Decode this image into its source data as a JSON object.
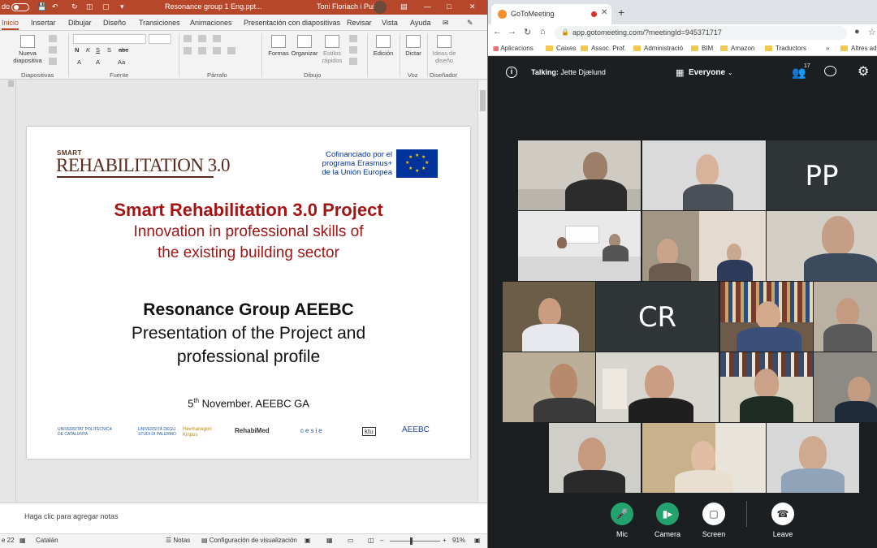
{
  "powerpoint": {
    "title_bar": {
      "autosave_label": "do",
      "file_name": "Resonance group 1 Eng.ppt...",
      "user_name": "Toni Floriach i Puig"
    },
    "ribbon_tabs": [
      "Inicio",
      "Insertar",
      "Dibujar",
      "Diseño",
      "Transiciones",
      "Animaciones",
      "Presentación con diapositivas",
      "Revisar",
      "Vista",
      "Ayuda"
    ],
    "ribbon": {
      "new_slide": "Nueva diapositiva",
      "shapes": "Formas",
      "arrange": "Organizar",
      "quick_styles": "Estilos rápidos",
      "edit": "Edición",
      "dictate": "Dictar",
      "design_ideas": "Ideas de diseño",
      "groups": [
        "Diapositivas",
        "Fuente",
        "Párrafo",
        "Dibujo",
        "Voz",
        "Diseñador"
      ]
    },
    "slide": {
      "logo_small": "SMART",
      "logo_big": "REHABILITATION 3.0",
      "eu_line1": "Cofinanciado por el",
      "eu_line2": "programa Erasmus+",
      "eu_line3": "de la Unión Europea",
      "title": "Smart Rehabilitation 3.0 Project",
      "subtitle1": "Innovation in professional skills of",
      "subtitle2": "the existing building sector",
      "group_title": "Resonance Group AEEBC",
      "presentation1": "Presentation of the Project and",
      "presentation2": "professional profile",
      "date_day": "5",
      "date_sup": "th",
      "date_rest": " November. AEEBC GA",
      "partners": [
        "UNIVERSITAT POLITÈCNICA DE CATALUNYA",
        "UNIVERSITÀ DEGLI STUDI DI PALERMO",
        "Hevmanegon Kinpos",
        "RehabiMed",
        "cesie",
        "ktu",
        "AEEBC"
      ]
    },
    "notes_placeholder": "Haga clic para agregar notas",
    "status": {
      "slide": "e 22",
      "language": "Catalán",
      "notes": "Notas",
      "view_settings": "Configuración de visualización",
      "zoom": "91%"
    }
  },
  "browser": {
    "tab_title": "GoToMeeting",
    "url": "app.gotomeeting.com/?meetingId=945371717",
    "bookmarks": [
      "Aplicacions",
      "Caixes",
      "Assoc. Prof.",
      "Administració",
      "BIM",
      "Amazon",
      "Traductors",
      "Altres ad"
    ]
  },
  "meeting": {
    "talking_label": "Talking:",
    "talking_name": "Jette Djælund",
    "view": "Everyone",
    "participant_count": "17",
    "tile_initials": [
      "PP",
      "CR"
    ],
    "controls": {
      "mic": "Mic",
      "camera": "Camera",
      "screen": "Screen",
      "leave": "Leave"
    },
    "colors": {
      "accent_green": "#23a26d",
      "background": "#1b1f22"
    }
  }
}
